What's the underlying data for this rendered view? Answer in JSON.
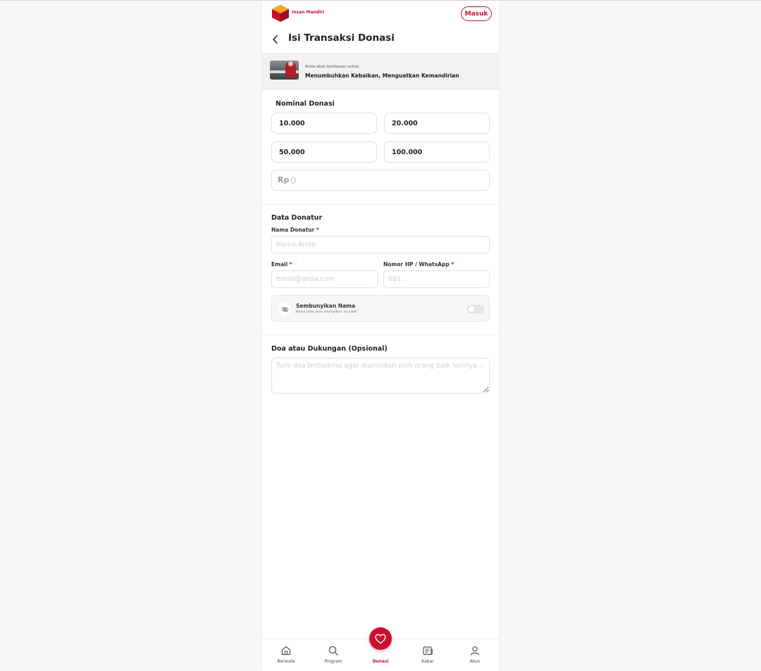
{
  "header": {
    "brand": "Insan Mandiri",
    "login_label": "Masuk",
    "title": "Isi Transaksi Donasi"
  },
  "campaign": {
    "intro": "Anda akan berdonasi untuk:",
    "title": "Menumbuhkan Kebaikan, Menguatkan Kemandirian"
  },
  "nominal": {
    "title": "Nominal Donasi",
    "options": [
      "10.000",
      "20.000",
      "50.000",
      "100.000"
    ],
    "currency": "Rp",
    "custom_placeholder": "0"
  },
  "donor": {
    "title": "Data Donatur",
    "name_label": "Nama Donatur",
    "name_placeholder": "Nama Anda",
    "email_label": "Email",
    "email_placeholder": "email@anda.com",
    "phone_label": "Nomor HP / WhatsApp",
    "phone_placeholder": "081...",
    "required_mark": "*",
    "hide_name_title": "Sembunyikan Nama",
    "hide_name_sub": "Nama tidak akan ditampilkan di publik"
  },
  "doa": {
    "title": "Doa atau Dukungan (Opsional)",
    "placeholder": "Tulis doa terbaikmu agar diaminkan oleh orang baik lainnya..."
  },
  "nav": {
    "items": [
      {
        "label": "Beranda",
        "icon": "home-icon"
      },
      {
        "label": "Program",
        "icon": "search-icon"
      },
      {
        "label": "Donasi",
        "icon": "heart-icon"
      },
      {
        "label": "Kabar",
        "icon": "news-icon"
      },
      {
        "label": "Akun",
        "icon": "user-icon"
      }
    ]
  },
  "colors": {
    "brand": "#c8102e",
    "background": "#f7f7f7"
  }
}
